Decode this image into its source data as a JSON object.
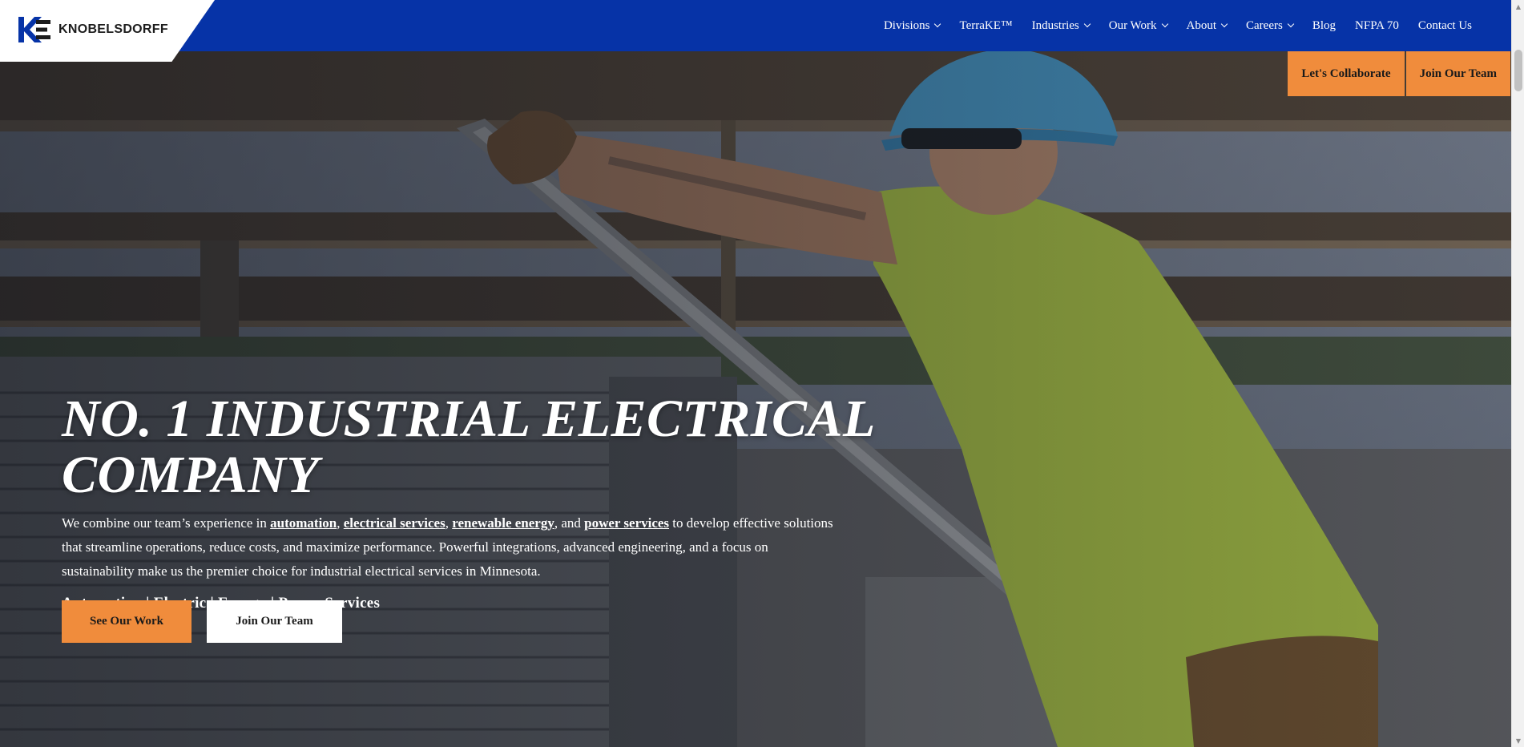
{
  "brand": {
    "name": "KNOBELSDORFF",
    "logo_icon": "ke-monogram-icon",
    "colors": {
      "nav_blue": "#0633a7",
      "accent_orange": "#f08c3c"
    }
  },
  "nav": {
    "items": [
      {
        "label": "Divisions",
        "dropdown": true
      },
      {
        "label": "TerraKE™",
        "dropdown": false
      },
      {
        "label": "Industries",
        "dropdown": true
      },
      {
        "label": "Our Work",
        "dropdown": true
      },
      {
        "label": "About",
        "dropdown": true
      },
      {
        "label": "Careers",
        "dropdown": true
      },
      {
        "label": "Blog",
        "dropdown": false
      },
      {
        "label": "NFPA 70",
        "dropdown": false
      },
      {
        "label": "Contact Us",
        "dropdown": false
      }
    ]
  },
  "header_cta": {
    "collaborate_label": "Let's Collaborate",
    "join_label": "Join Our Team"
  },
  "hero": {
    "headline": "NO. 1 INDUSTRIAL ELECTRICAL COMPANY",
    "lead": {
      "part1": "We combine our team’s experience in ",
      "link_automation": "automation",
      "sep1": ", ",
      "link_electrical": "electrical services",
      "sep2": ", ",
      "link_renewable": "renewable energy",
      "sep3": ", and ",
      "link_power": "power services",
      "part2": " to develop effective solutions that streamline operations, reduce costs, and maximize performance. Powerful integrations, advanced engineering, and a focus on sustainability make us the premier choice for industrial electrical services in Minnesota."
    },
    "tagline": "Automation | Electric | Energy | Power Services",
    "button_primary": "See Our Work",
    "button_secondary": "Join Our Team"
  },
  "scrollbar": {
    "up_icon": "scroll-up-arrow-icon",
    "down_icon": "scroll-down-arrow-icon"
  }
}
